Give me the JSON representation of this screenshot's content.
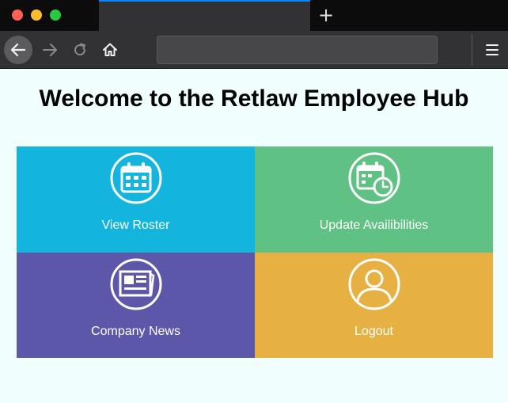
{
  "browser": {
    "new_tab_symbol": "+",
    "icons": [
      "back-arrow-icon",
      "forward-arrow-icon",
      "reload-icon",
      "home-icon",
      "hamburger-menu-icon",
      "plus-icon"
    ],
    "address_value": ""
  },
  "page": {
    "title": "Welcome to the Retlaw Employee Hub"
  },
  "tiles": [
    {
      "label": "View Roster",
      "icon": "calendar-icon",
      "color": "#13b4dd"
    },
    {
      "label": "Update Availibilities",
      "icon": "calendar-clock-icon",
      "color": "#60c184"
    },
    {
      "label": "Company News",
      "icon": "newspaper-icon",
      "color": "#5d57a9"
    },
    {
      "label": "Logout",
      "icon": "user-profile-icon",
      "color": "#e6b142"
    }
  ],
  "colors": {
    "page_background": "#f0fffe",
    "chrome_dark": "#0c0c0d",
    "chrome_toolbar": "#323234",
    "active_tab_accent": "#0a84ff"
  }
}
